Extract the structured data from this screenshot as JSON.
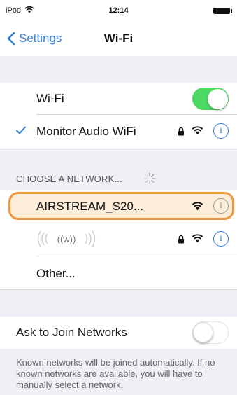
{
  "status_bar": {
    "carrier": "iPod",
    "time": "12:14"
  },
  "nav": {
    "back_label": "Settings",
    "title": "Wi-Fi"
  },
  "wifi_row": {
    "label": "Wi-Fi",
    "toggle_on": true
  },
  "connected_network": {
    "name": "Monitor Audio WiFi",
    "secured": true,
    "info": "i"
  },
  "section_header": "CHOOSE A NETWORK...",
  "networks": [
    {
      "name": "AIRSTREAM_S20...",
      "secured": false,
      "highlighted": true,
      "info": "i"
    },
    {
      "name": "",
      "secured": true,
      "highlighted": false,
      "info": "i",
      "icon": "hidden-ssid-waves-icon"
    },
    {
      "name": "Other...",
      "secured": false,
      "highlighted": false
    }
  ],
  "ask_to_join": {
    "label": "Ask to Join Networks",
    "toggle_on": false
  },
  "footer": "Known networks will be joined automatically. If no known networks are available, you will have to manually select a network.",
  "colors": {
    "accent": "#2f7fd9",
    "toggle_on": "#4cd964",
    "highlight": "#f0963c",
    "group_background": "#eef0f5"
  }
}
